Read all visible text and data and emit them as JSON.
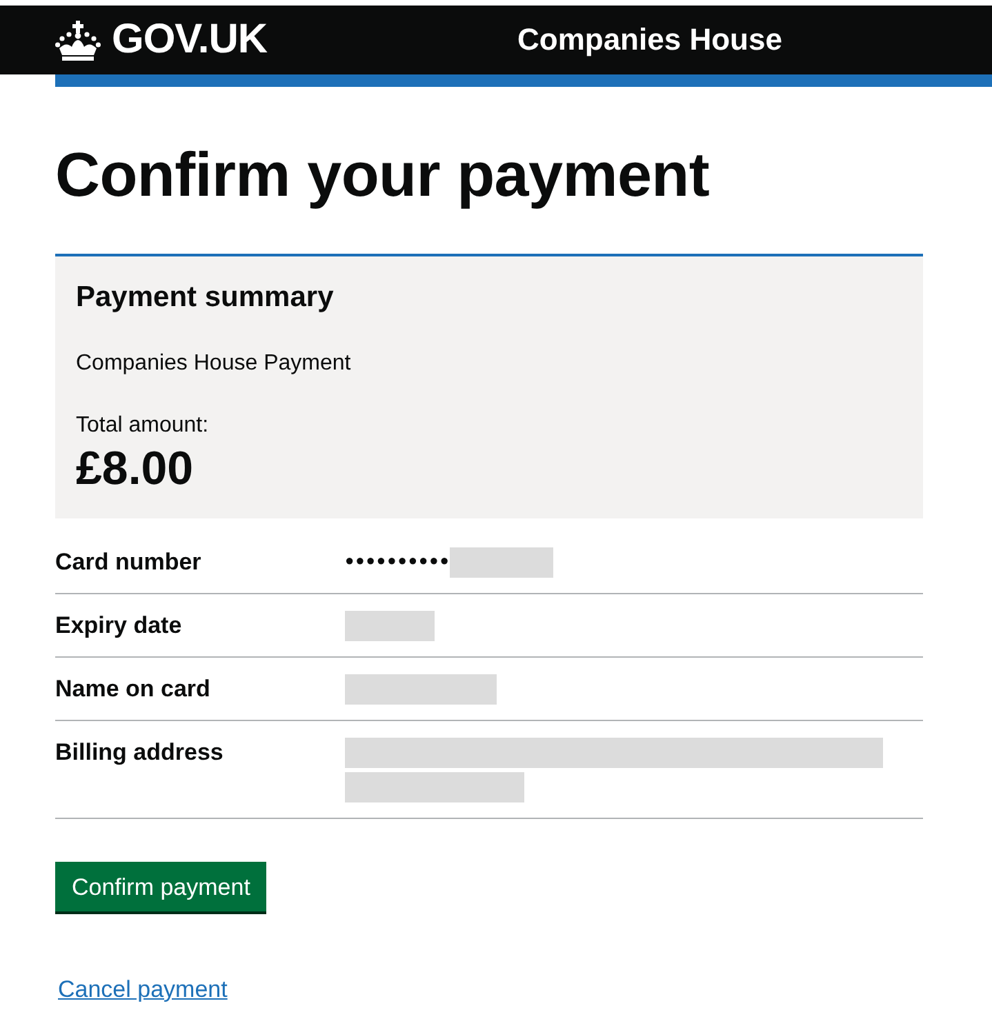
{
  "header": {
    "logo_text": "GOV.UK",
    "service_name": "Companies House"
  },
  "heading": "Confirm your payment",
  "summary": {
    "title": "Payment summary",
    "description": "Companies House Payment",
    "total_label": "Total amount:",
    "total_value": "£8.00"
  },
  "details": [
    {
      "label": "Card number",
      "value": "●●●●●●●●●●",
      "kind": "single",
      "redacted": true
    },
    {
      "label": "Expiry date",
      "kind": "single",
      "redacted": true
    },
    {
      "label": "Name on card",
      "kind": "single",
      "redacted": true
    },
    {
      "label": "Billing address",
      "kind": "multi",
      "redacted": true
    }
  ],
  "confirm_button": "Confirm payment",
  "cancel_link": "Cancel payment"
}
